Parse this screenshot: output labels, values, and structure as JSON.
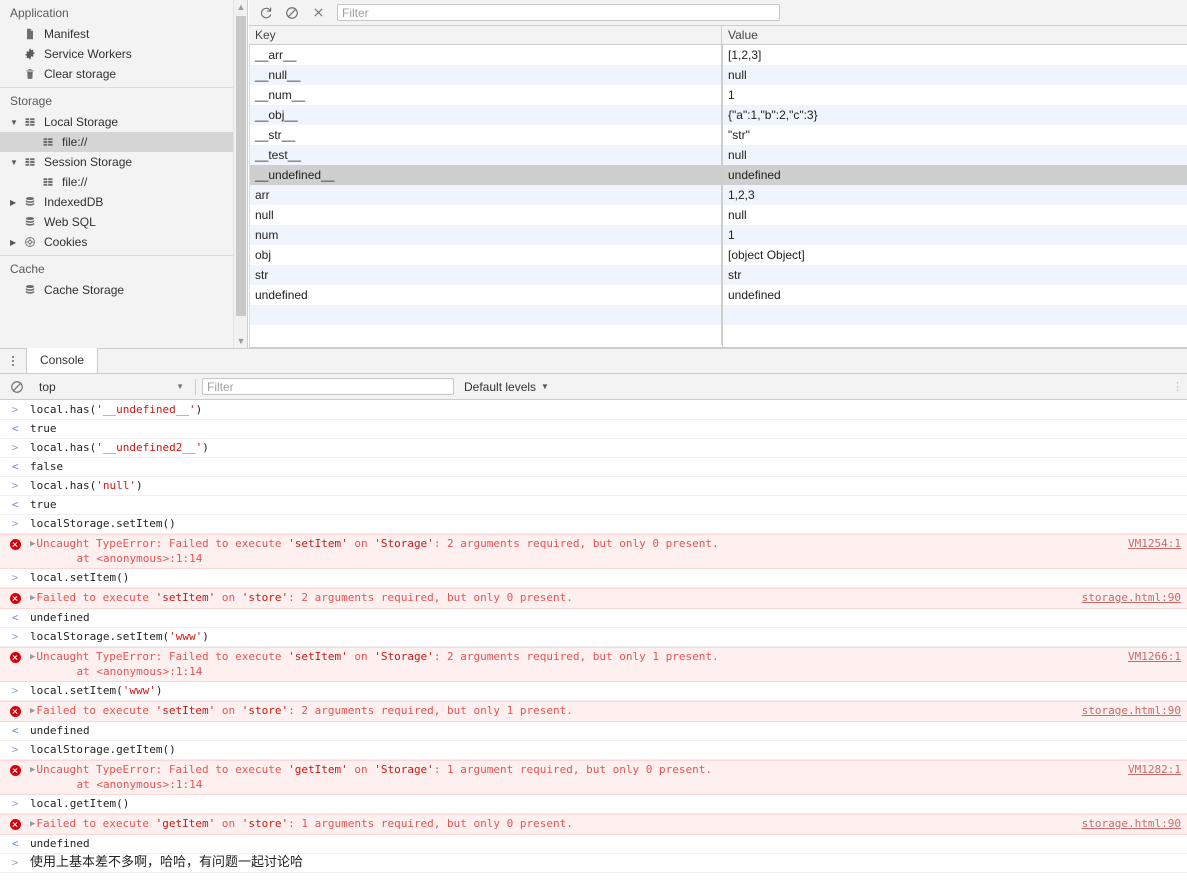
{
  "sidebar": {
    "groups": [
      {
        "title": "Application",
        "items": [
          {
            "label": "Manifest",
            "icon": "manifest-icon",
            "indent": 1,
            "twisty": "none",
            "selected": false
          },
          {
            "label": "Service Workers",
            "icon": "gear-icon",
            "indent": 1,
            "twisty": "none",
            "selected": false
          },
          {
            "label": "Clear storage",
            "icon": "trash-icon",
            "indent": 1,
            "twisty": "none",
            "selected": false
          }
        ]
      },
      {
        "title": "Storage",
        "items": [
          {
            "label": "Local Storage",
            "icon": "table-icon",
            "indent": 1,
            "twisty": "expanded",
            "selected": false
          },
          {
            "label": "file://",
            "icon": "table-icon",
            "indent": 2,
            "twisty": "none",
            "selected": true
          },
          {
            "label": "Session Storage",
            "icon": "table-icon",
            "indent": 1,
            "twisty": "expanded",
            "selected": false
          },
          {
            "label": "file://",
            "icon": "table-icon",
            "indent": 2,
            "twisty": "none",
            "selected": false
          },
          {
            "label": "IndexedDB",
            "icon": "database-icon",
            "indent": 1,
            "twisty": "collapsed",
            "selected": false
          },
          {
            "label": "Web SQL",
            "icon": "database-icon",
            "indent": 1,
            "twisty": "none",
            "selected": false
          },
          {
            "label": "Cookies",
            "icon": "cookie-icon",
            "indent": 1,
            "twisty": "collapsed",
            "selected": false
          }
        ]
      },
      {
        "title": "Cache",
        "items": [
          {
            "label": "Cache Storage",
            "icon": "database-icon",
            "indent": 1,
            "twisty": "none",
            "selected": false
          }
        ]
      }
    ]
  },
  "storage_toolbar": {
    "refresh_icon": "refresh-icon",
    "clear_icon": "no-entry-icon",
    "delete_icon": "close-icon",
    "filter_placeholder": "Filter",
    "filter_value": ""
  },
  "storage_table": {
    "columns": [
      "Key",
      "Value"
    ],
    "rows": [
      {
        "key": "__arr__",
        "value": "[1,2,3]",
        "selected": false
      },
      {
        "key": "__null__",
        "value": "null",
        "selected": false
      },
      {
        "key": "__num__",
        "value": "1",
        "selected": false
      },
      {
        "key": "__obj__",
        "value": "{\"a\":1,\"b\":2,\"c\":3}",
        "selected": false
      },
      {
        "key": "__str__",
        "value": "\"str\"",
        "selected": false
      },
      {
        "key": "__test__",
        "value": "null",
        "selected": false
      },
      {
        "key": "__undefined__",
        "value": "undefined",
        "selected": true
      },
      {
        "key": "arr",
        "value": "1,2,3",
        "selected": false
      },
      {
        "key": "null",
        "value": "null",
        "selected": false
      },
      {
        "key": "num",
        "value": "1",
        "selected": false
      },
      {
        "key": "obj",
        "value": "[object Object]",
        "selected": false
      },
      {
        "key": "str",
        "value": "str",
        "selected": false
      },
      {
        "key": "undefined",
        "value": "undefined",
        "selected": false
      },
      {
        "key": "",
        "value": "",
        "selected": false
      },
      {
        "key": "",
        "value": "",
        "selected": false
      }
    ]
  },
  "drawer": {
    "menu_icon": "more-vertical-icon",
    "tabs": [
      {
        "label": "Console",
        "active": true
      }
    ]
  },
  "console_toolbar": {
    "clear_icon": "no-entry-icon",
    "context": "top",
    "context_caret": "chevron-down-icon",
    "filter_placeholder": "Filter",
    "filter_value": "",
    "levels": "Default levels",
    "levels_caret": "chevron-down-icon",
    "settings_icon": "more-vertical-icon"
  },
  "console_messages": [
    {
      "type": "input",
      "text": "local.has('__undefined__')"
    },
    {
      "type": "output",
      "text": "true"
    },
    {
      "type": "input",
      "text": "local.has('__undefined2__')"
    },
    {
      "type": "output",
      "text": "false"
    },
    {
      "type": "input",
      "text": "local.has('null')"
    },
    {
      "type": "output",
      "text": "true"
    },
    {
      "type": "input",
      "text": "localStorage.setItem()"
    },
    {
      "type": "error",
      "text": "Uncaught TypeError: Failed to execute 'setItem' on 'Storage': 2 arguments required, but only 0 present.",
      "stack": "    at <anonymous>:1:14",
      "source": "VM1254:1"
    },
    {
      "type": "input",
      "text": "local.setItem()"
    },
    {
      "type": "error",
      "text": "Failed to execute 'setItem' on 'store': 2 arguments required, but only 0 present.",
      "stack": "",
      "source": "storage.html:90"
    },
    {
      "type": "output",
      "text": "undefined"
    },
    {
      "type": "input",
      "text": "localStorage.setItem('www')"
    },
    {
      "type": "error",
      "text": "Uncaught TypeError: Failed to execute 'setItem' on 'Storage': 2 arguments required, but only 1 present.",
      "stack": "    at <anonymous>:1:14",
      "source": "VM1266:1"
    },
    {
      "type": "input",
      "text": "local.setItem('www')"
    },
    {
      "type": "error",
      "text": "Failed to execute 'setItem' on 'store': 2 arguments required, but only 1 present.",
      "stack": "",
      "source": "storage.html:90"
    },
    {
      "type": "output",
      "text": "undefined"
    },
    {
      "type": "input",
      "text": "localStorage.getItem()"
    },
    {
      "type": "error",
      "text": "Uncaught TypeError: Failed to execute 'getItem' on 'Storage': 1 argument required, but only 0 present.",
      "stack": "    at <anonymous>:1:14",
      "source": "VM1282:1"
    },
    {
      "type": "input",
      "text": "local.getItem()"
    },
    {
      "type": "error",
      "text": "Failed to execute 'getItem' on 'store': 1 arguments required, but only 0 present.",
      "stack": "",
      "source": "storage.html:90"
    },
    {
      "type": "output",
      "text": "undefined"
    },
    {
      "type": "input",
      "text": "使用上基本差不多啊，哈哈，有问题一起讨论哈",
      "cjk": true
    }
  ],
  "colors": {
    "error_text": "#e45454",
    "error_bg": "#fff0f0",
    "selected_row": "#cfcfcf",
    "odd_row": "#eff5fd",
    "link": "#5555aa",
    "toolbar_bg": "#f3f3f3"
  }
}
